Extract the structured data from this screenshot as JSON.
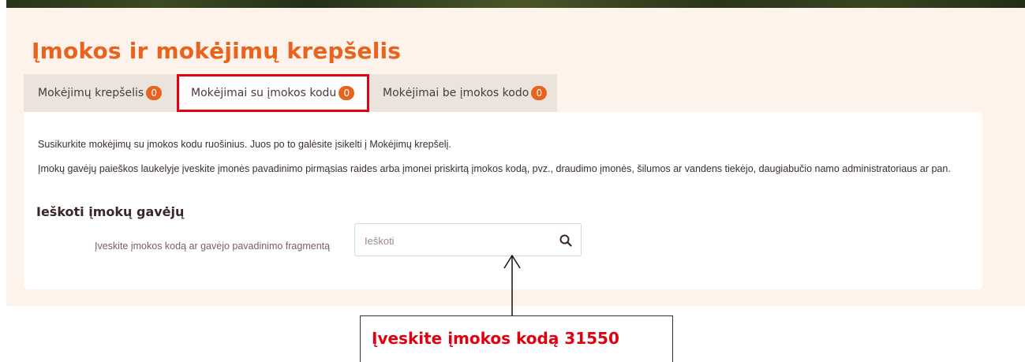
{
  "page": {
    "title": "Įmokos ir mokėjimų krepšelis"
  },
  "tabs": [
    {
      "label": "Mokėjimų krepšelis",
      "count": "0"
    },
    {
      "label": "Mokėjimai su įmokos kodu",
      "count": "0",
      "active": true
    },
    {
      "label": "Mokėjimai be įmokos kodo",
      "count": "0"
    }
  ],
  "content": {
    "intro": "Susikurkite mokėjimų su įmokos kodu ruošinius. Juos po to galėsite įsikelti į Mokėjimų krepšelį.",
    "help": "Įmokų gavėjų paieškos laukelyje įveskite įmonės pavadinimo pirmąsias raides arba įmonei priskirtą įmokos kodą, pvz., draudimo įmonės, šilumos ar vandens tiekėjo, daugiabučio namo administratoriaus ar pan."
  },
  "search": {
    "heading": "Ieškoti įmokų gavėjų",
    "label": "Įveskite įmokos kodą ar gavėjo pavadinimo fragmentą",
    "placeholder": "Ieškoti",
    "value": ""
  },
  "annotation": {
    "text": "Įveskite įmokos kodą 31550"
  },
  "colors": {
    "accent": "#e8641e",
    "highlight": "#e1000f",
    "panel_bg": "#fdf3ea",
    "tab_bar_bg": "#ebe4dd"
  },
  "icons": {
    "search": "search-icon",
    "arrow": "arrow-up-icon"
  }
}
